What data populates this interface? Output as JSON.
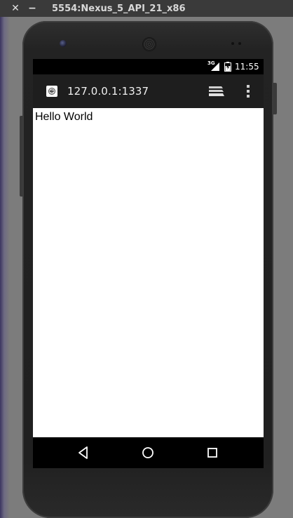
{
  "window": {
    "title": "5554:Nexus_5_API_21_x86",
    "close_glyph": "✕",
    "minimize_glyph": "−"
  },
  "statusbar": {
    "network_label": "3G",
    "time": "11:55"
  },
  "browser": {
    "url": "127.0.0.1:1337",
    "site_icon": "globe-icon",
    "tabs_icon": "tabs-stack-icon",
    "menu_icon": "overflow-menu-icon"
  },
  "page": {
    "text": "Hello World"
  },
  "navigation": {
    "back_icon": "back-triangle-icon",
    "home_icon": "home-circle-icon",
    "recent_icon": "recent-apps-square-icon"
  },
  "colors": {
    "titlebar": "#3a3a3a",
    "phone_body": "#222222",
    "toolbar": "#1e1e1e",
    "page_background": "#ffffff",
    "navbar": "#000000"
  }
}
